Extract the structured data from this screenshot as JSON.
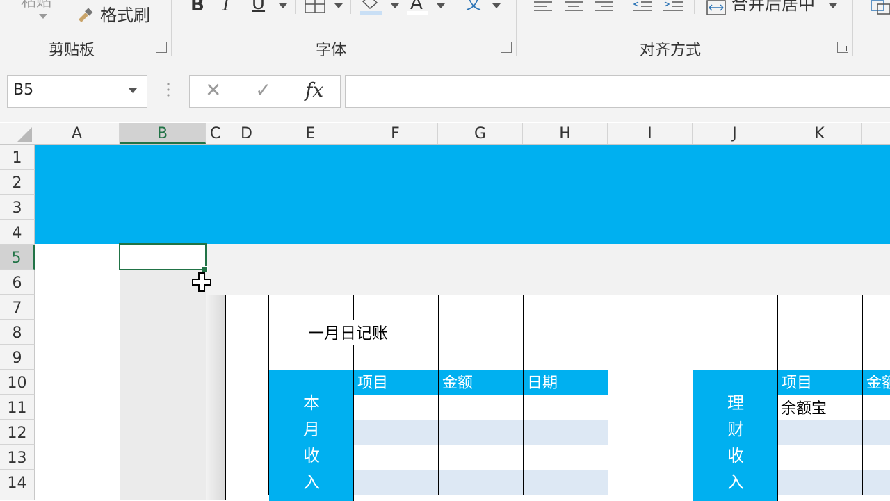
{
  "ribbon": {
    "paste_label": "粘贴",
    "format_painter_label": "格式刷",
    "groups": {
      "clipboard": "剪贴板",
      "font": "字体",
      "alignment": "对齐方式"
    },
    "bold": "B",
    "italic": "I",
    "underline": "U",
    "font_color": "A",
    "phonetic": "文",
    "merge_center": "合并后居中"
  },
  "formula_bar": {
    "name_box": "B5",
    "fx": "fx",
    "cancel": "✕",
    "enter": "✓",
    "formula": ""
  },
  "columns": [
    "A",
    "B",
    "C",
    "D",
    "E",
    "F",
    "G",
    "H",
    "I",
    "J",
    "K"
  ],
  "rows": [
    "1",
    "2",
    "3",
    "4",
    "5",
    "6",
    "7",
    "8",
    "9",
    "10",
    "11",
    "12",
    "13",
    "14"
  ],
  "sheet": {
    "title": "一月日记账",
    "income_section_label": [
      "本",
      "月",
      "收",
      "入"
    ],
    "finance_section_label": [
      "理",
      "财",
      "收",
      "入"
    ],
    "income_headers": [
      "项目",
      "金额",
      "日期"
    ],
    "finance_headers": [
      "项目",
      "金额"
    ],
    "finance_item_1": "余额宝"
  },
  "colors": {
    "banner": "#00b0f0",
    "header_fill": "#00b0f0",
    "band_fill": "#dde8f4",
    "selection": "#217346"
  }
}
